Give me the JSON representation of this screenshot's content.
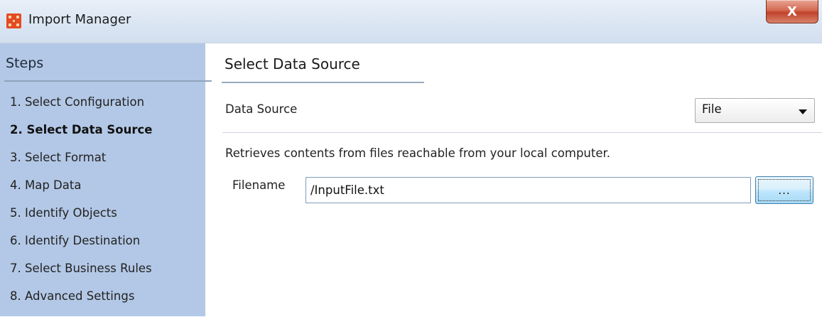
{
  "window": {
    "title": "Import Manager",
    "close_glyph": "X",
    "app_icon": "import-manager-icon",
    "close_icon": "close-icon"
  },
  "sidebar": {
    "header": "Steps",
    "items": [
      {
        "label": "1. Select Configuration",
        "active": false
      },
      {
        "label": "2. Select Data Source",
        "active": true
      },
      {
        "label": "3. Select Format",
        "active": false
      },
      {
        "label": "4. Map Data",
        "active": false
      },
      {
        "label": "5. Identify Objects",
        "active": false
      },
      {
        "label": "6. Identify Destination",
        "active": false
      },
      {
        "label": "7. Select Business Rules",
        "active": false
      },
      {
        "label": "8. Advanced Settings",
        "active": false
      }
    ]
  },
  "main": {
    "title": "Select Data Source",
    "data_source": {
      "label": "Data Source",
      "selected": "File"
    },
    "description": "Retrieves contents from files reachable from your local computer.",
    "filename": {
      "label": "Filename",
      "value": "/InputFile.txt"
    },
    "browse_button": {
      "label": "..."
    }
  },
  "colors": {
    "sidebar_bg": "#b3c8e6",
    "close_button": "#c7432b",
    "accent_border": "#3c7fb1"
  }
}
